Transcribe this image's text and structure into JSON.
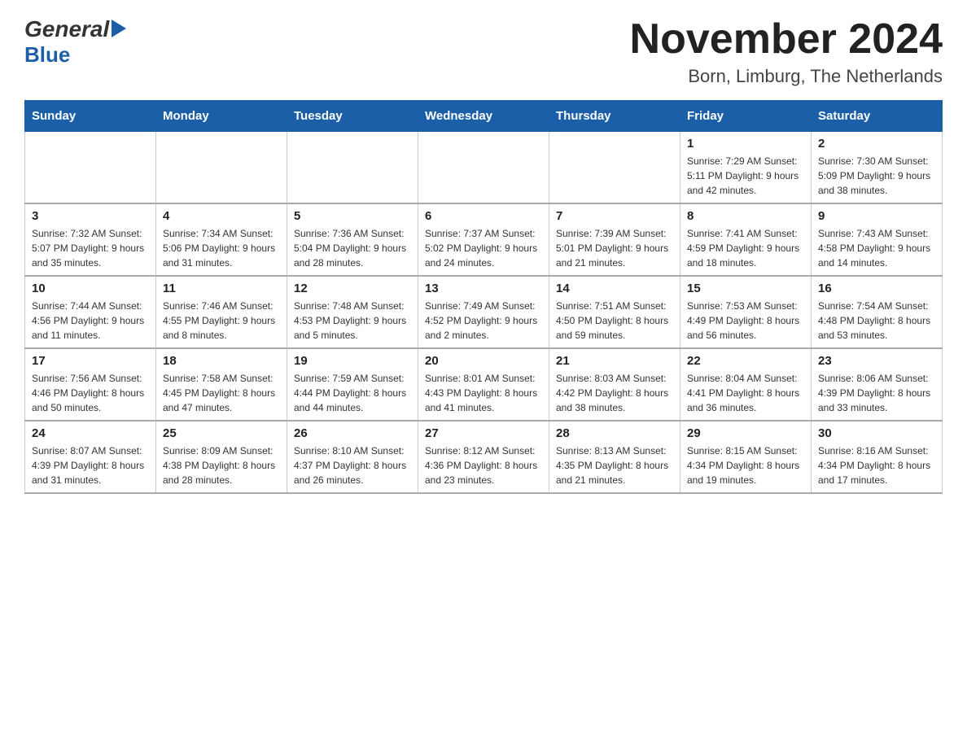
{
  "logo": {
    "general": "General",
    "blue": "Blue"
  },
  "title": "November 2024",
  "subtitle": "Born, Limburg, The Netherlands",
  "weekdays": [
    "Sunday",
    "Monday",
    "Tuesday",
    "Wednesday",
    "Thursday",
    "Friday",
    "Saturday"
  ],
  "weeks": [
    [
      {
        "day": "",
        "info": ""
      },
      {
        "day": "",
        "info": ""
      },
      {
        "day": "",
        "info": ""
      },
      {
        "day": "",
        "info": ""
      },
      {
        "day": "",
        "info": ""
      },
      {
        "day": "1",
        "info": "Sunrise: 7:29 AM\nSunset: 5:11 PM\nDaylight: 9 hours\nand 42 minutes."
      },
      {
        "day": "2",
        "info": "Sunrise: 7:30 AM\nSunset: 5:09 PM\nDaylight: 9 hours\nand 38 minutes."
      }
    ],
    [
      {
        "day": "3",
        "info": "Sunrise: 7:32 AM\nSunset: 5:07 PM\nDaylight: 9 hours\nand 35 minutes."
      },
      {
        "day": "4",
        "info": "Sunrise: 7:34 AM\nSunset: 5:06 PM\nDaylight: 9 hours\nand 31 minutes."
      },
      {
        "day": "5",
        "info": "Sunrise: 7:36 AM\nSunset: 5:04 PM\nDaylight: 9 hours\nand 28 minutes."
      },
      {
        "day": "6",
        "info": "Sunrise: 7:37 AM\nSunset: 5:02 PM\nDaylight: 9 hours\nand 24 minutes."
      },
      {
        "day": "7",
        "info": "Sunrise: 7:39 AM\nSunset: 5:01 PM\nDaylight: 9 hours\nand 21 minutes."
      },
      {
        "day": "8",
        "info": "Sunrise: 7:41 AM\nSunset: 4:59 PM\nDaylight: 9 hours\nand 18 minutes."
      },
      {
        "day": "9",
        "info": "Sunrise: 7:43 AM\nSunset: 4:58 PM\nDaylight: 9 hours\nand 14 minutes."
      }
    ],
    [
      {
        "day": "10",
        "info": "Sunrise: 7:44 AM\nSunset: 4:56 PM\nDaylight: 9 hours\nand 11 minutes."
      },
      {
        "day": "11",
        "info": "Sunrise: 7:46 AM\nSunset: 4:55 PM\nDaylight: 9 hours\nand 8 minutes."
      },
      {
        "day": "12",
        "info": "Sunrise: 7:48 AM\nSunset: 4:53 PM\nDaylight: 9 hours\nand 5 minutes."
      },
      {
        "day": "13",
        "info": "Sunrise: 7:49 AM\nSunset: 4:52 PM\nDaylight: 9 hours\nand 2 minutes."
      },
      {
        "day": "14",
        "info": "Sunrise: 7:51 AM\nSunset: 4:50 PM\nDaylight: 8 hours\nand 59 minutes."
      },
      {
        "day": "15",
        "info": "Sunrise: 7:53 AM\nSunset: 4:49 PM\nDaylight: 8 hours\nand 56 minutes."
      },
      {
        "day": "16",
        "info": "Sunrise: 7:54 AM\nSunset: 4:48 PM\nDaylight: 8 hours\nand 53 minutes."
      }
    ],
    [
      {
        "day": "17",
        "info": "Sunrise: 7:56 AM\nSunset: 4:46 PM\nDaylight: 8 hours\nand 50 minutes."
      },
      {
        "day": "18",
        "info": "Sunrise: 7:58 AM\nSunset: 4:45 PM\nDaylight: 8 hours\nand 47 minutes."
      },
      {
        "day": "19",
        "info": "Sunrise: 7:59 AM\nSunset: 4:44 PM\nDaylight: 8 hours\nand 44 minutes."
      },
      {
        "day": "20",
        "info": "Sunrise: 8:01 AM\nSunset: 4:43 PM\nDaylight: 8 hours\nand 41 minutes."
      },
      {
        "day": "21",
        "info": "Sunrise: 8:03 AM\nSunset: 4:42 PM\nDaylight: 8 hours\nand 38 minutes."
      },
      {
        "day": "22",
        "info": "Sunrise: 8:04 AM\nSunset: 4:41 PM\nDaylight: 8 hours\nand 36 minutes."
      },
      {
        "day": "23",
        "info": "Sunrise: 8:06 AM\nSunset: 4:39 PM\nDaylight: 8 hours\nand 33 minutes."
      }
    ],
    [
      {
        "day": "24",
        "info": "Sunrise: 8:07 AM\nSunset: 4:39 PM\nDaylight: 8 hours\nand 31 minutes."
      },
      {
        "day": "25",
        "info": "Sunrise: 8:09 AM\nSunset: 4:38 PM\nDaylight: 8 hours\nand 28 minutes."
      },
      {
        "day": "26",
        "info": "Sunrise: 8:10 AM\nSunset: 4:37 PM\nDaylight: 8 hours\nand 26 minutes."
      },
      {
        "day": "27",
        "info": "Sunrise: 8:12 AM\nSunset: 4:36 PM\nDaylight: 8 hours\nand 23 minutes."
      },
      {
        "day": "28",
        "info": "Sunrise: 8:13 AM\nSunset: 4:35 PM\nDaylight: 8 hours\nand 21 minutes."
      },
      {
        "day": "29",
        "info": "Sunrise: 8:15 AM\nSunset: 4:34 PM\nDaylight: 8 hours\nand 19 minutes."
      },
      {
        "day": "30",
        "info": "Sunrise: 8:16 AM\nSunset: 4:34 PM\nDaylight: 8 hours\nand 17 minutes."
      }
    ]
  ],
  "colors": {
    "header_bg": "#1a5fa8",
    "header_text": "#ffffff",
    "border": "#cccccc"
  }
}
